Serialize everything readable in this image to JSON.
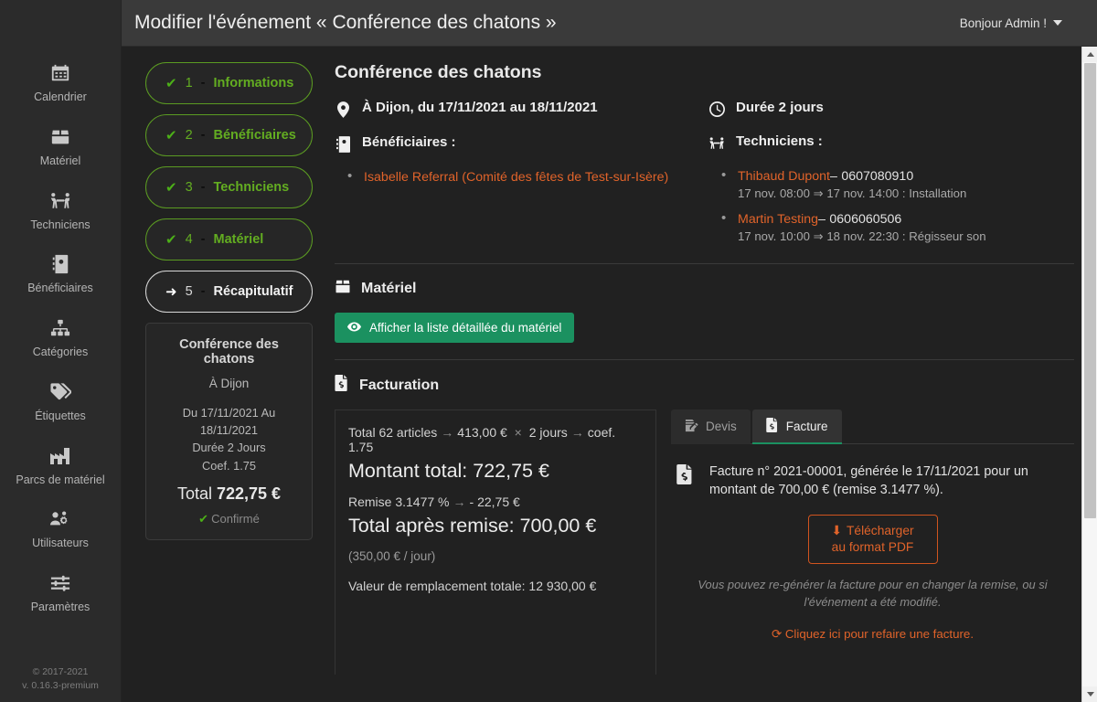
{
  "sidebar": {
    "logo_text": "",
    "items": [
      {
        "label": "Calendrier",
        "icon": "calendar-icon"
      },
      {
        "label": "Matériel",
        "icon": "box-icon"
      },
      {
        "label": "Techniciens",
        "icon": "people-carry-icon"
      },
      {
        "label": "Bénéficiaires",
        "icon": "address-book-icon"
      },
      {
        "label": "Catégories",
        "icon": "sitemap-icon"
      },
      {
        "label": "Étiquettes",
        "icon": "tags-icon"
      },
      {
        "label": "Parcs de matériel",
        "icon": "warehouse-icon"
      },
      {
        "label": "Utilisateurs",
        "icon": "users-cog-icon"
      },
      {
        "label": "Paramètres",
        "icon": "sliders-icon"
      }
    ],
    "footer_copyright": "© 2017-2021",
    "footer_version": "v. 0.16.3-premium"
  },
  "topbar": {
    "title": "Modifier l'événement « Conférence des chatons »",
    "user_greeting": "Bonjour Admin !"
  },
  "steps": [
    {
      "num": "1",
      "sep": "-",
      "label": "Informations",
      "state": "done",
      "icon": "check-icon"
    },
    {
      "num": "2",
      "sep": "-",
      "label": "Bénéficiaires",
      "state": "done",
      "icon": "check-icon"
    },
    {
      "num": "3",
      "sep": "-",
      "label": "Techniciens",
      "state": "done",
      "icon": "check-icon"
    },
    {
      "num": "4",
      "sep": "-",
      "label": "Matériel",
      "state": "done",
      "icon": "check-icon"
    },
    {
      "num": "5",
      "sep": "-",
      "label": "Récapitulatif",
      "state": "active",
      "icon": "arrow-right-icon"
    }
  ],
  "summary_card": {
    "title": "Conférence des chatons",
    "location": "À Dijon",
    "dates": "Du 17/11/2021 Au 18/11/2021",
    "duration": "Durée 2 Jours",
    "coef": "Coef. 1.75",
    "total_prefix": "Total",
    "total_amount": "722,75 €",
    "status": "Confirmé"
  },
  "event": {
    "title": "Conférence des chatons",
    "location_line": "À Dijon, du 17/11/2021 au 18/11/2021",
    "duration_line": "Durée 2 jours",
    "beneficiaries_heading": "Bénéficiaires :",
    "beneficiaries": [
      {
        "name": "Isabelle Referral (Comité des fêtes de Test-sur-Isère)"
      }
    ],
    "technicians_heading": "Techniciens :",
    "technicians": [
      {
        "name": "Thibaud Dupont",
        "dash": "–",
        "phone": "0607080910",
        "schedule": "17 nov. 08:00 ⇒ 17 nov. 14:00 : Installation"
      },
      {
        "name": "Martin Testing",
        "dash": "–",
        "phone": "0606060506",
        "schedule": "17 nov. 10:00 ⇒ 18 nov. 22:30 : Régisseur son"
      }
    ]
  },
  "material": {
    "heading": "Matériel",
    "button_label": "Afficher la liste détaillée du matériel"
  },
  "billing": {
    "heading": "Facturation",
    "totals_line_prefix": "Total 62 articles",
    "unit_price": "413,00 €",
    "times": "×",
    "days": "2 jours",
    "coef": "coef. 1.75",
    "arrow": "→",
    "amount_label": "Montant total: 722,75 €",
    "discount_line_label": "Remise 3.1477 %",
    "discount_value": "- 22,75 €",
    "after_discount_label": "Total après remise: 700,00 €",
    "per_day": "(350,00 € / jour)",
    "replacement_value": "Valeur de remplacement totale: 12 930,00 €"
  },
  "invoice_panel": {
    "tabs": [
      {
        "label": "Devis",
        "icon": "quote-file-icon",
        "selected": false
      },
      {
        "label": "Facture",
        "icon": "invoice-file-icon",
        "selected": true
      }
    ],
    "description": "Facture n° 2021-00001, générée le 17/11/2021 pour un montant de 700,00 € (remise 3.1477 %).",
    "download_button_label": "Télécharger au format PDF",
    "note": "Vous pouvez re-générer la facture pour en changer la remise, ou si l'événement a été modifié.",
    "redo_link": "Cliquez ici pour refaire une facture."
  },
  "colors": {
    "accent_green": "#63ad21",
    "button_green": "#1b9160",
    "accent_orange": "#e0632a",
    "sidebar_bg": "#2b2b2b",
    "topbar_bg": "#3a3a3a",
    "content_bg": "#212121"
  }
}
